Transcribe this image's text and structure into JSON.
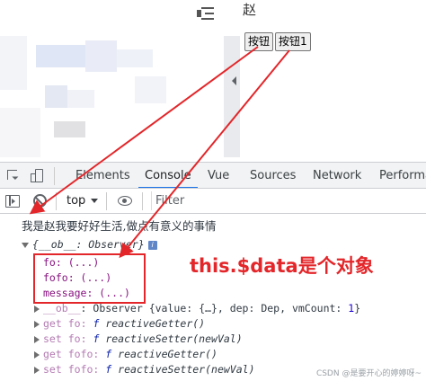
{
  "app": {
    "title_char": "赵",
    "buttons": [
      "按钮",
      "按钮1"
    ]
  },
  "devtools": {
    "tabs": [
      "Elements",
      "Console",
      "Vue",
      "Sources",
      "Network",
      "Performa"
    ],
    "active_tab": "Console"
  },
  "console_toolbar": {
    "context": "top",
    "filter_placeholder": "Filter"
  },
  "console": {
    "log_message": "我是赵我要好好生活,做点有意义的事情",
    "object_header": "{__ob__: Observer}",
    "props": [
      "fo: (...)",
      "fofo: (...)",
      "message: (...)"
    ],
    "ob_line": {
      "key": "__ob__",
      "text": ": Observer {value: {…}, dep: Dep, vmCount: ",
      "count": "1",
      "close": "}"
    },
    "accessors": [
      {
        "kw": "get",
        "key": "fo",
        "fn": "reactiveGetter()"
      },
      {
        "kw": "set",
        "key": "fo",
        "fn": "reactiveSetter(newVal)"
      },
      {
        "kw": "get",
        "key": "fofo",
        "fn": "reactiveGetter()"
      },
      {
        "kw": "set",
        "key": "fofo",
        "fn": "reactiveSetter(newVal)"
      }
    ],
    "fn_glyph": "f"
  },
  "annotation": {
    "text": "this.$data是个对象",
    "color": "#e3262a"
  },
  "watermark": "CSDN @是要开心的婷婷呀~"
}
